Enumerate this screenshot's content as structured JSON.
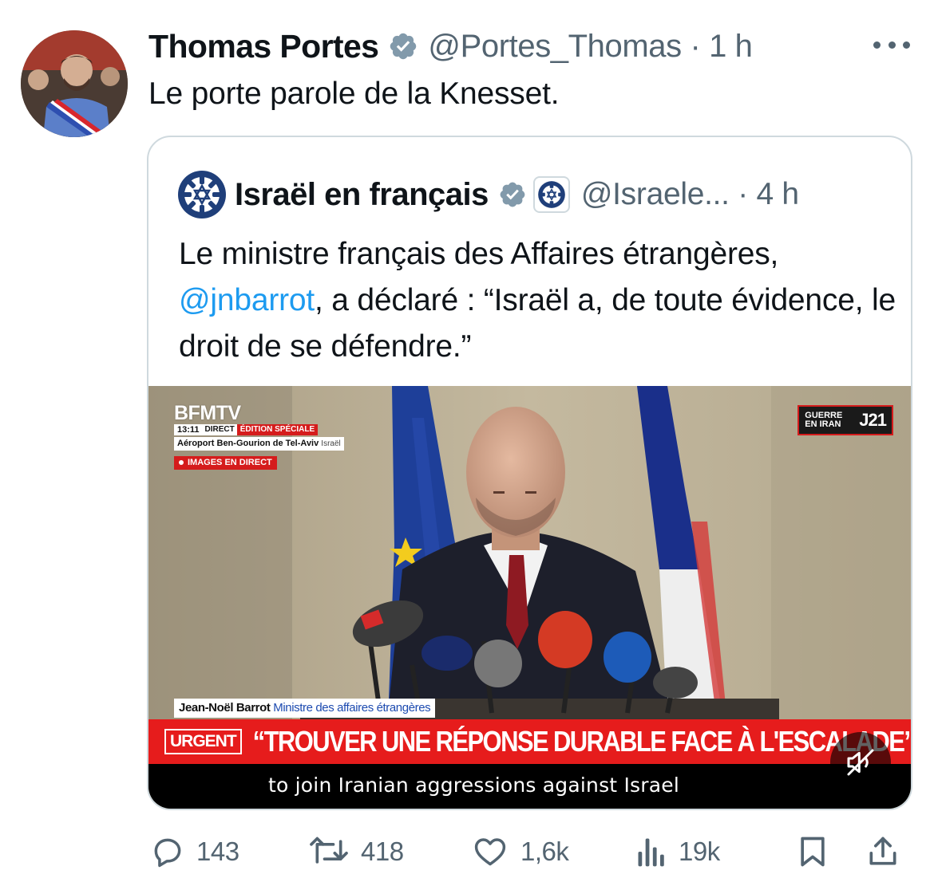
{
  "tweet": {
    "author_name": "Thomas Portes",
    "handle_time": "@Portes_Thomas · 1 h",
    "text": "Le porte parole de la Knesset."
  },
  "quoted": {
    "author_name": "Israël en français",
    "handle_time": "@Israele... · 4 h",
    "text_before": "Le ministre français des Affaires étrangères, ",
    "mention": "@jnbarrot",
    "text_after": ", a déclaré : “Israël a, de toute évidence, le droit de se défendre.”",
    "video": {
      "channel": "BFMTV",
      "time": "13:11",
      "direct": "DIRECT",
      "edition": "ÉDITION SPÉCIALE",
      "location": "Aéroport Ben-Gourion de Tel-Aviv",
      "location_country": "Israël",
      "live_badge": "IMAGES EN DIRECT",
      "corner_badge": "GUERRE EN IRAN",
      "corner_day": "J21",
      "person_name": "Jean-Noël Barrot",
      "person_role": "Ministre des affaires étrangères",
      "urgent_tag": "URGENT",
      "headline": "“TROUVER UNE RÉPONSE DURABLE FACE À L'ESCALADE”",
      "subtitle": "to join Iranian aggressions against Israel"
    }
  },
  "actions": {
    "replies": "143",
    "reposts": "418",
    "likes": "1,6k",
    "views": "19k"
  },
  "colors": {
    "text": "#0f1419",
    "secondary": "#536471",
    "link": "#1d9bf0",
    "verified": "#829aab",
    "urgent_red": "#e61c1c",
    "border": "#cfd9de"
  },
  "icons": [
    "verified-badge-icon",
    "more-icon",
    "israel-logo-icon",
    "reply-icon",
    "repost-icon",
    "like-icon",
    "views-icon",
    "bookmark-icon",
    "share-icon",
    "mute-icon"
  ]
}
